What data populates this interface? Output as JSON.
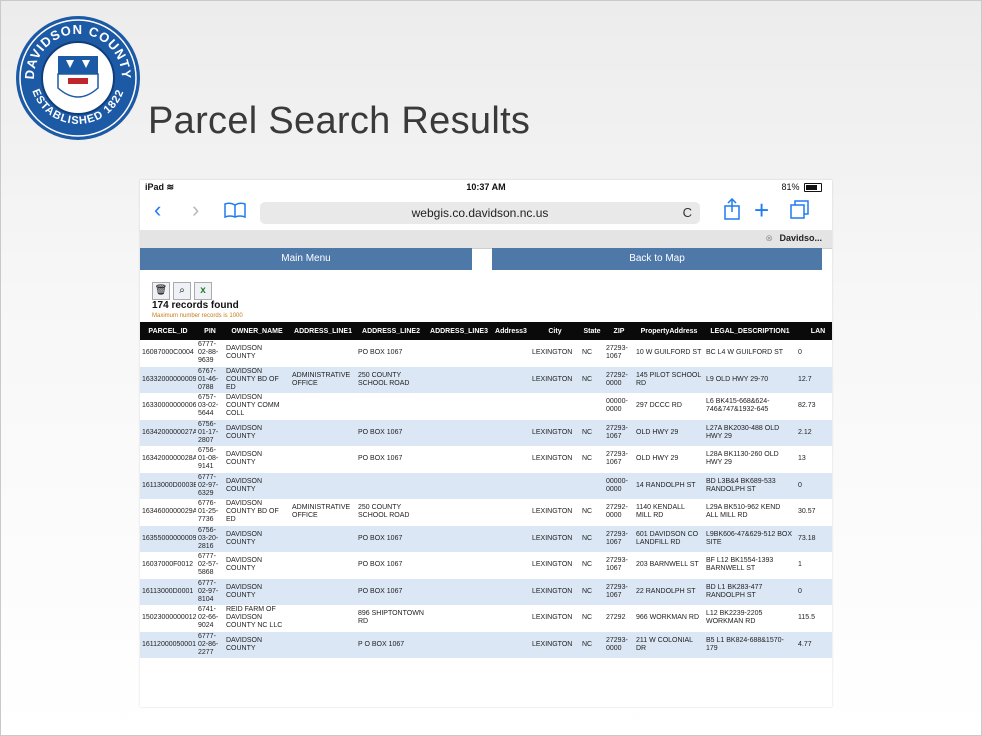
{
  "slide": {
    "title": "Parcel Search Results",
    "seal_text_top": "DAVIDSON COUNTY",
    "seal_text_bottom": "ESTABLISHED 1822"
  },
  "statusbar": {
    "device": "iPad",
    "wifi": "wifi-icon",
    "time": "10:37 AM",
    "battery": "81%"
  },
  "browser": {
    "url": "webgis.co.davidson.nc.us",
    "tab_label": "Davidso...",
    "buttons": {
      "back": "‹",
      "forward": "›",
      "bookmarks": "book-icon",
      "reload": "C",
      "share": "share-icon",
      "add": "+",
      "tabs": "tabs-icon"
    }
  },
  "page": {
    "main_menu": "Main Menu",
    "back_to_map": "Back to Map",
    "records_found": "174 records found",
    "max_note": "Maximum number records is 1000"
  },
  "table": {
    "columns": [
      "PARCEL_ID",
      "PIN",
      "OWNER_NAME",
      "ADDRESS_LINE1",
      "ADDRESS_LINE2",
      "ADDRESS_LINE3",
      "Address3",
      "City",
      "State",
      "ZIP",
      "PropertyAddress",
      "LEGAL_DESCRIPTION1",
      "LAN"
    ],
    "rows": [
      [
        "16087000C0004",
        "6777-02-88-9639",
        "DAVIDSON COUNTY",
        "",
        "PO BOX 1067",
        "",
        "",
        "LEXINGTON",
        "NC",
        "27293-1067",
        "10 W GUILFORD ST",
        "BC L4 W GUILFORD ST",
        "0"
      ],
      [
        "16332000000009",
        "6767-01-46-0788",
        "DAVIDSON COUNTY BD OF ED",
        "ADMINISTRATIVE OFFICE",
        "250 COUNTY SCHOOL ROAD",
        "",
        "",
        "LEXINGTON",
        "NC",
        "27292-0000",
        "145 PILOT SCHOOL RD",
        "L9 OLD HWY 29-70",
        "12.7"
      ],
      [
        "16330000000006",
        "6757-03-02-5644",
        "DAVIDSON COUNTY COMM COLL",
        "",
        "",
        "",
        "",
        "",
        "",
        "00000-0000",
        "297 DCCC RD",
        "L6 BK415-668&624-746&747&1932-645",
        "82.73"
      ],
      [
        "1634200000027A",
        "6756-01-17-2807",
        "DAVIDSON COUNTY",
        "",
        "PO BOX 1067",
        "",
        "",
        "LEXINGTON",
        "NC",
        "27293-1067",
        "OLD HWY 29",
        "L27A BK2030-488 OLD HWY 29",
        "2.12"
      ],
      [
        "1634200000028A",
        "6756-01-08-9141",
        "DAVIDSON COUNTY",
        "",
        "PO BOX 1067",
        "",
        "",
        "LEXINGTON",
        "NC",
        "27293-1067",
        "OLD HWY 29",
        "L28A BK1130-260 OLD HWY 29",
        "13"
      ],
      [
        "16113000D0003B",
        "6777-02-97-6329",
        "DAVIDSON COUNTY",
        "",
        "",
        "",
        "",
        "",
        "",
        "00000-0000",
        "14 RANDOLPH ST",
        "BD L3B&4 BK689-533 RANDOLPH ST",
        "0"
      ],
      [
        "1634600000029A",
        "6776-01-25-7736",
        "DAVIDSON COUNTY BD OF ED",
        "ADMINISTRATIVE OFFICE",
        "250 COUNTY SCHOOL ROAD",
        "",
        "",
        "LEXINGTON",
        "NC",
        "27292-0000",
        "1140 KENDALL MILL RD",
        "L29A BK510-962 KEND ALL MILL RD",
        "30.57"
      ],
      [
        "16355000000009",
        "6756-03-20-2816",
        "DAVIDSON COUNTY",
        "",
        "PO BOX 1067",
        "",
        "",
        "LEXINGTON",
        "NC",
        "27293-1067",
        "601 DAVIDSON CO LANDFILL RD",
        "L9BK606-47&629-512 BOX SITE",
        "73.18"
      ],
      [
        "16037000F0012",
        "6777-02-57-5868",
        "DAVIDSON COUNTY",
        "",
        "PO BOX 1067",
        "",
        "",
        "LEXINGTON",
        "NC",
        "27293-1067",
        "203 BARNWELL ST",
        "BF L12 BK1554-1393 BARNWELL ST",
        "1"
      ],
      [
        "16113000D0001",
        "6777-02-97-8104",
        "DAVIDSON COUNTY",
        "",
        "PO BOX 1067",
        "",
        "",
        "LEXINGTON",
        "NC",
        "27293-1067",
        "22 RANDOLPH ST",
        "BD L1 BK283-477 RANDOLPH ST",
        "0"
      ],
      [
        "15023000000012",
        "6741-02-66-9024",
        "REID FARM OF DAVIDSON COUNTY NC LLC",
        "",
        "896 SHIPTONTOWN RD",
        "",
        "",
        "LEXINGTON",
        "NC",
        "27292",
        "966 WORKMAN RD",
        "L12 BK2239-2205 WORKMAN RD",
        "115.5"
      ],
      [
        "16112000050001",
        "6777-02-86-2277",
        "DAVIDSON COUNTY",
        "",
        "P O BOX 1067",
        "",
        "",
        "LEXINGTON",
        "NC",
        "27293-0000",
        "211 W COLONIAL DR",
        "B5 L1 BK824-688&1570-179",
        "4.77"
      ]
    ]
  }
}
